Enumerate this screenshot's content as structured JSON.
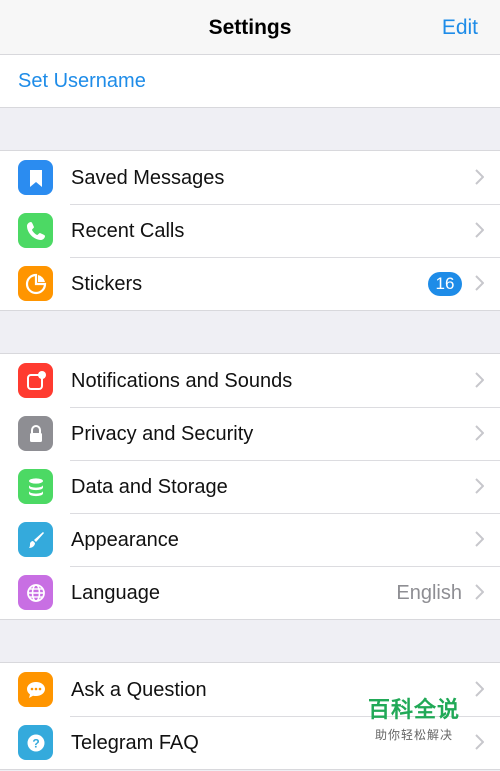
{
  "header": {
    "title": "Settings",
    "edit_label": "Edit"
  },
  "account": {
    "set_username_label": "Set Username"
  },
  "groups": [
    {
      "items": [
        {
          "label": "Saved Messages",
          "icon": "bookmark-icon",
          "color": "#2b8cf0"
        },
        {
          "label": "Recent Calls",
          "icon": "phone-icon",
          "color": "#4cd964"
        },
        {
          "label": "Stickers",
          "icon": "sticker-icon",
          "color": "#ff9500",
          "badge": "16"
        }
      ]
    },
    {
      "items": [
        {
          "label": "Notifications and Sounds",
          "icon": "notification-icon",
          "color": "#ff3b30"
        },
        {
          "label": "Privacy and Security",
          "icon": "lock-icon",
          "color": "#8e8e93"
        },
        {
          "label": "Data and Storage",
          "icon": "database-icon",
          "color": "#4cd964"
        },
        {
          "label": "Appearance",
          "icon": "brush-icon",
          "color": "#34aadc"
        },
        {
          "label": "Language",
          "icon": "globe-icon",
          "color": "#c86fe3",
          "value": "English"
        }
      ]
    },
    {
      "items": [
        {
          "label": "Ask a Question",
          "icon": "chat-bubble-icon",
          "color": "#ff9500"
        },
        {
          "label": "Telegram FAQ",
          "icon": "help-icon",
          "color": "#34aadc"
        }
      ]
    }
  ],
  "watermark": {
    "title": "百科全说",
    "subtitle": "助你轻松解决"
  }
}
